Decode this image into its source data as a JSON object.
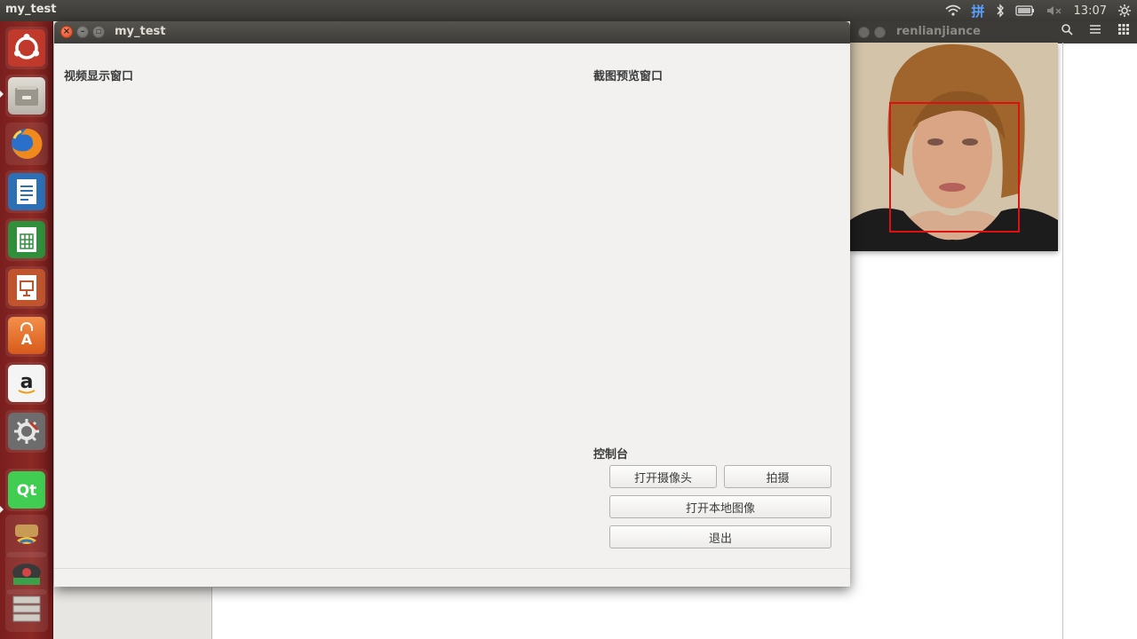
{
  "top_panel": {
    "app_title": "my_test",
    "clock": "13:07",
    "input_method": "拼"
  },
  "launcher": {
    "items": [
      {
        "name": "ubuntu-dash-icon"
      },
      {
        "name": "files-icon"
      },
      {
        "name": "firefox-icon"
      },
      {
        "name": "writer-icon"
      },
      {
        "name": "calc-icon"
      },
      {
        "name": "impress-icon"
      },
      {
        "name": "software-center-icon"
      },
      {
        "name": "amazon-icon"
      },
      {
        "name": "system-settings-icon"
      },
      {
        "name": "qt-creator-icon"
      },
      {
        "name": "python-icon"
      },
      {
        "name": "media-icon"
      },
      {
        "name": "disks-icon"
      }
    ]
  },
  "bg_window": {
    "title": "renlianjiance"
  },
  "main_window": {
    "title": "my_test",
    "video_label": "视频显示窗口",
    "preview_label": "截图预览窗口",
    "console_label": "控制台",
    "buttons": {
      "open_camera": "打开摄像头",
      "capture": "拍摄",
      "open_local_image": "打开本地图像",
      "exit": "退出"
    }
  },
  "colors": {
    "accent_close": "#e0481f",
    "launcher_bg": "#8c2a24",
    "face_box": "#e01010"
  }
}
